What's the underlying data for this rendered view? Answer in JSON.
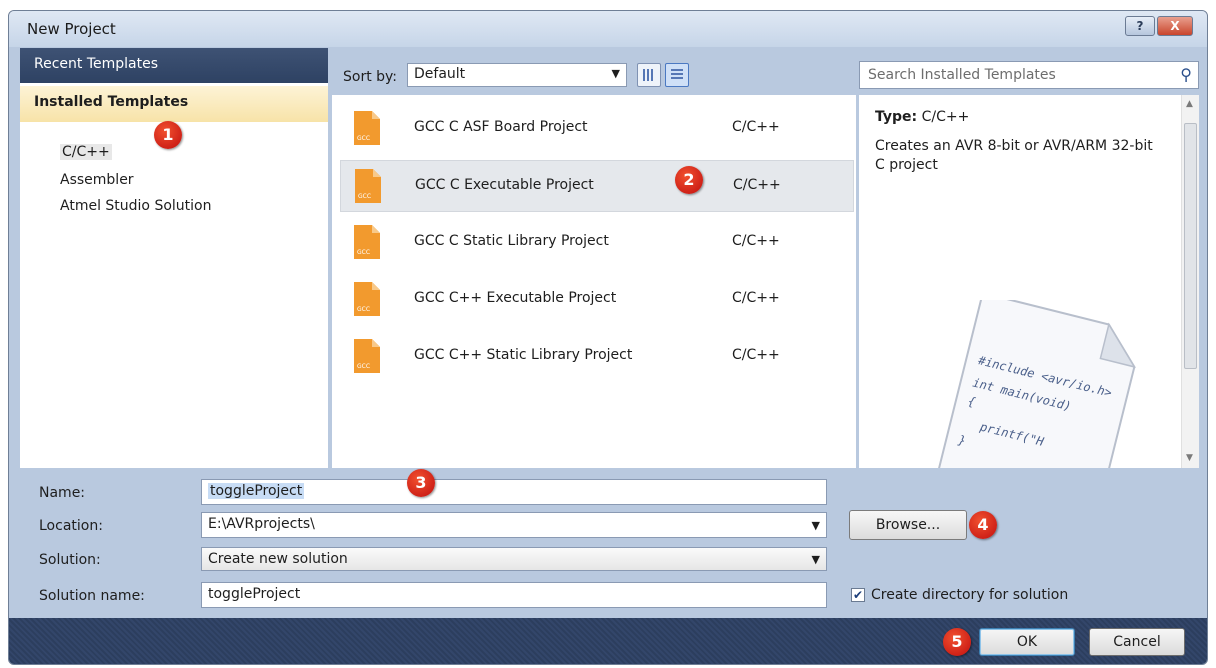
{
  "window": {
    "title": "New Project",
    "help_label": "?",
    "close_label": "X"
  },
  "left_pane": {
    "recent_templates": "Recent Templates",
    "installed_templates": "Installed Templates",
    "items": [
      {
        "label": "C/C++",
        "selected": true
      },
      {
        "label": "Assembler",
        "selected": false
      },
      {
        "label": "Atmel Studio Solution",
        "selected": false
      }
    ]
  },
  "toolbar": {
    "sort_by_label": "Sort by:",
    "sort_value": "Default",
    "search_placeholder": "Search Installed Templates"
  },
  "templates": [
    {
      "name": "GCC C ASF Board Project",
      "language": "C/C++",
      "icon_text": "GCC",
      "selected": false
    },
    {
      "name": "GCC C Executable Project",
      "language": "C/C++",
      "icon_text": "GCC",
      "selected": true
    },
    {
      "name": "GCC C Static Library Project",
      "language": "C/C++",
      "icon_text": "GCC",
      "selected": false
    },
    {
      "name": "GCC C++ Executable Project",
      "language": "C/C++",
      "icon_text": "GCC",
      "selected": false
    },
    {
      "name": "GCC C++ Static Library Project",
      "language": "C/C++",
      "icon_text": "GCC",
      "selected": false
    }
  ],
  "info": {
    "type_label": "Type:",
    "type_value": "C/C++",
    "description": "Creates an AVR 8-bit or AVR/ARM 32-bit C project",
    "preview_code": [
      "#include <avr/io.h>",
      "int main(void)",
      "{",
      "printf(\"H",
      "}"
    ]
  },
  "form": {
    "name_label": "Name:",
    "name_value": "toggleProject",
    "location_label": "Location:",
    "location_value": "E:\\AVRprojects\\",
    "solution_label": "Solution:",
    "solution_value": "Create new solution",
    "solution_name_label": "Solution name:",
    "solution_name_value": "toggleProject",
    "browse_label": "Browse...",
    "create_dir_label": "Create directory for solution",
    "create_dir_checked": true
  },
  "footer": {
    "ok_label": "OK",
    "cancel_label": "Cancel"
  },
  "annotations": [
    "1",
    "2",
    "3",
    "4",
    "5"
  ],
  "colors": {
    "accent_badge": "#d21a12",
    "icon_orange": "#f29a2e",
    "header_dark": "#2e4263",
    "installed_highlight": "#f7e3a8"
  }
}
